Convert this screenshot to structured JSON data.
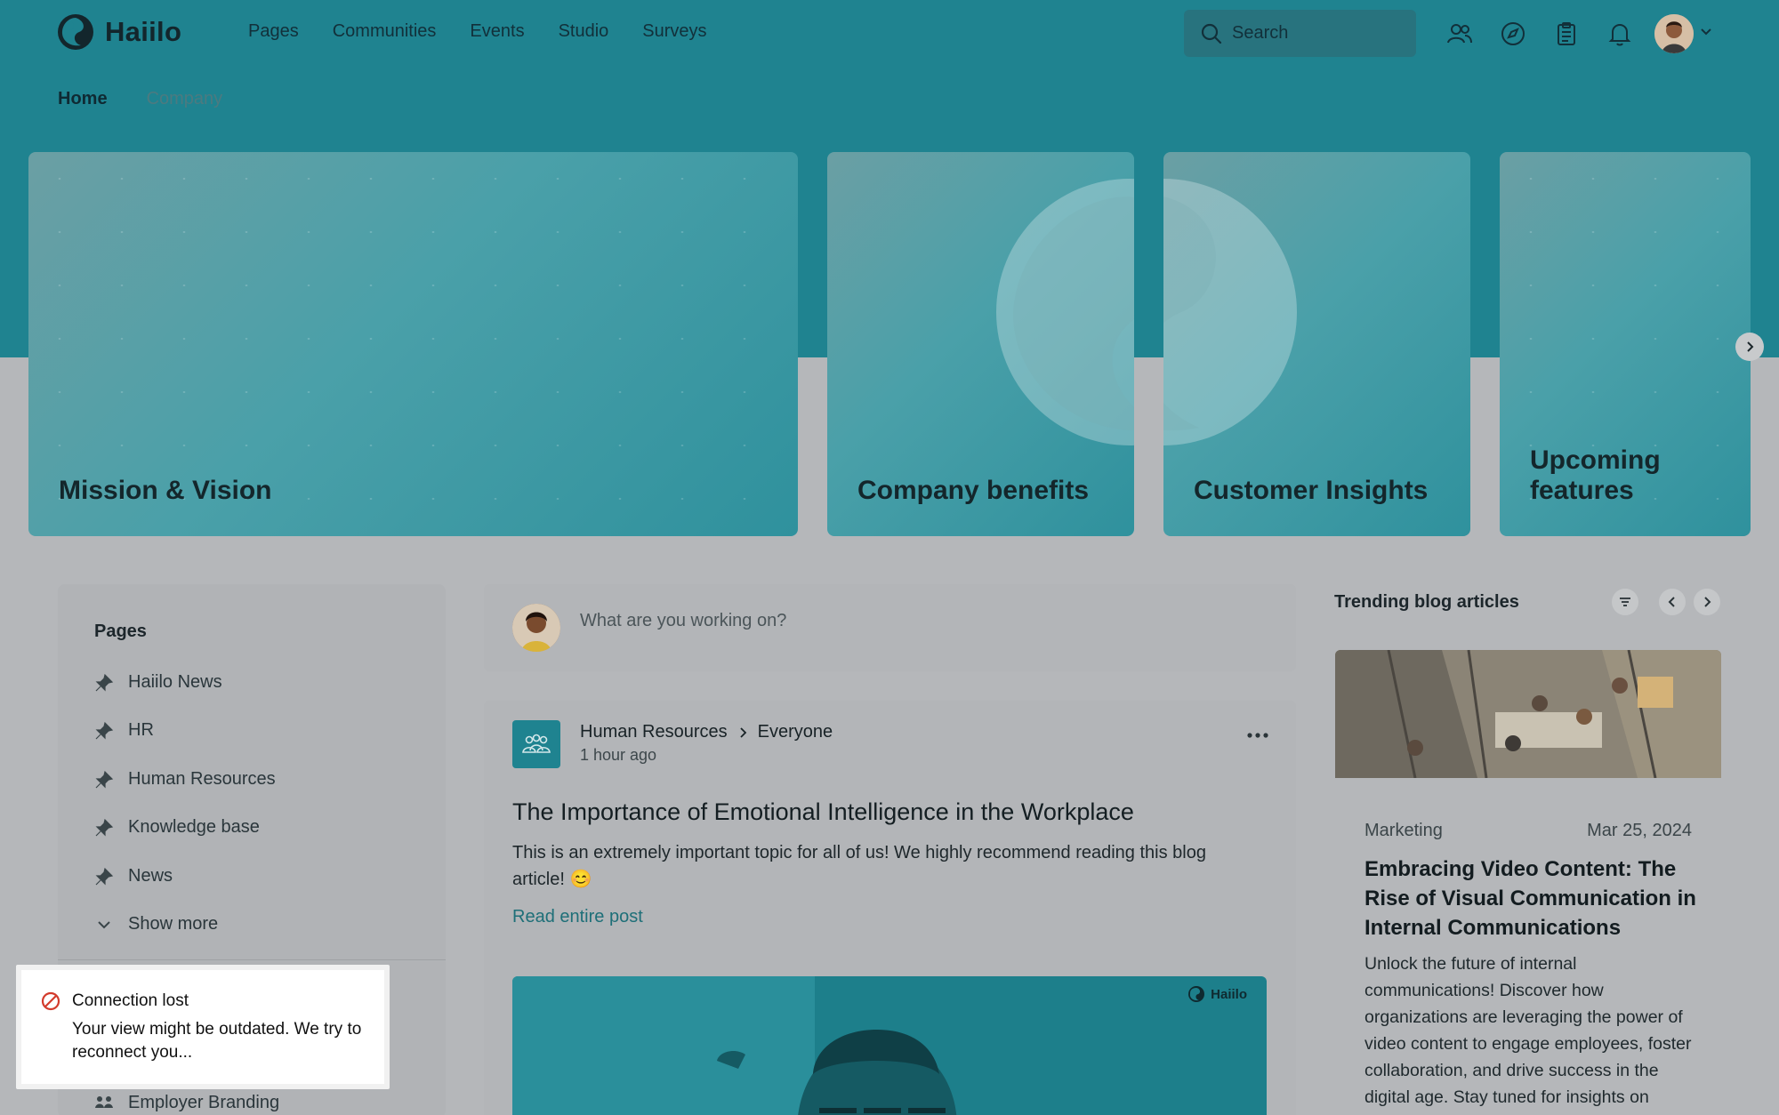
{
  "app": {
    "name": "Haiilo"
  },
  "nav": {
    "items": [
      "Pages",
      "Communities",
      "Events",
      "Studio",
      "Surveys"
    ]
  },
  "search": {
    "placeholder": "Search"
  },
  "subnav": {
    "home": "Home",
    "company": "Company"
  },
  "hero": {
    "cards": [
      "Mission & Vision",
      "Company benefits",
      "Customer Insights",
      "Upcoming features"
    ]
  },
  "pages_panel": {
    "title": "Pages",
    "items": [
      "Haiilo News",
      "HR",
      "Human Resources",
      "Knowledge base",
      "News"
    ],
    "show_more": "Show more",
    "employer_branding": "Employer Branding"
  },
  "composer": {
    "placeholder": "What are you working on?"
  },
  "post": {
    "source": "Human Resources",
    "target": "Everyone",
    "time": "1 hour ago",
    "title": "The Importance of Emotional Intelligence in the Workplace",
    "body": "This is an extremely important topic for all of us! We highly recommend reading this blog article! 😊",
    "read_more": "Read entire post",
    "image_logo": "Haiilo"
  },
  "trending": {
    "title": "Trending blog articles",
    "article": {
      "category": "Marketing",
      "date": "Mar 25, 2024",
      "title": "Embracing Video Content: The Rise of Visual Communication in Internal Communications",
      "text": "Unlock the future of internal communications! Discover how organizations are leveraging the power of video content to engage employees, foster collaboration, and drive success in the digital age. Stay tuned for insights on"
    }
  },
  "toast": {
    "title": "Connection lost",
    "message": "Your view might be outdated. We try to reconnect you..."
  },
  "colors": {
    "brand": "#1f8390",
    "overlay": "#b5b7ba",
    "error": "#d33b2c"
  }
}
